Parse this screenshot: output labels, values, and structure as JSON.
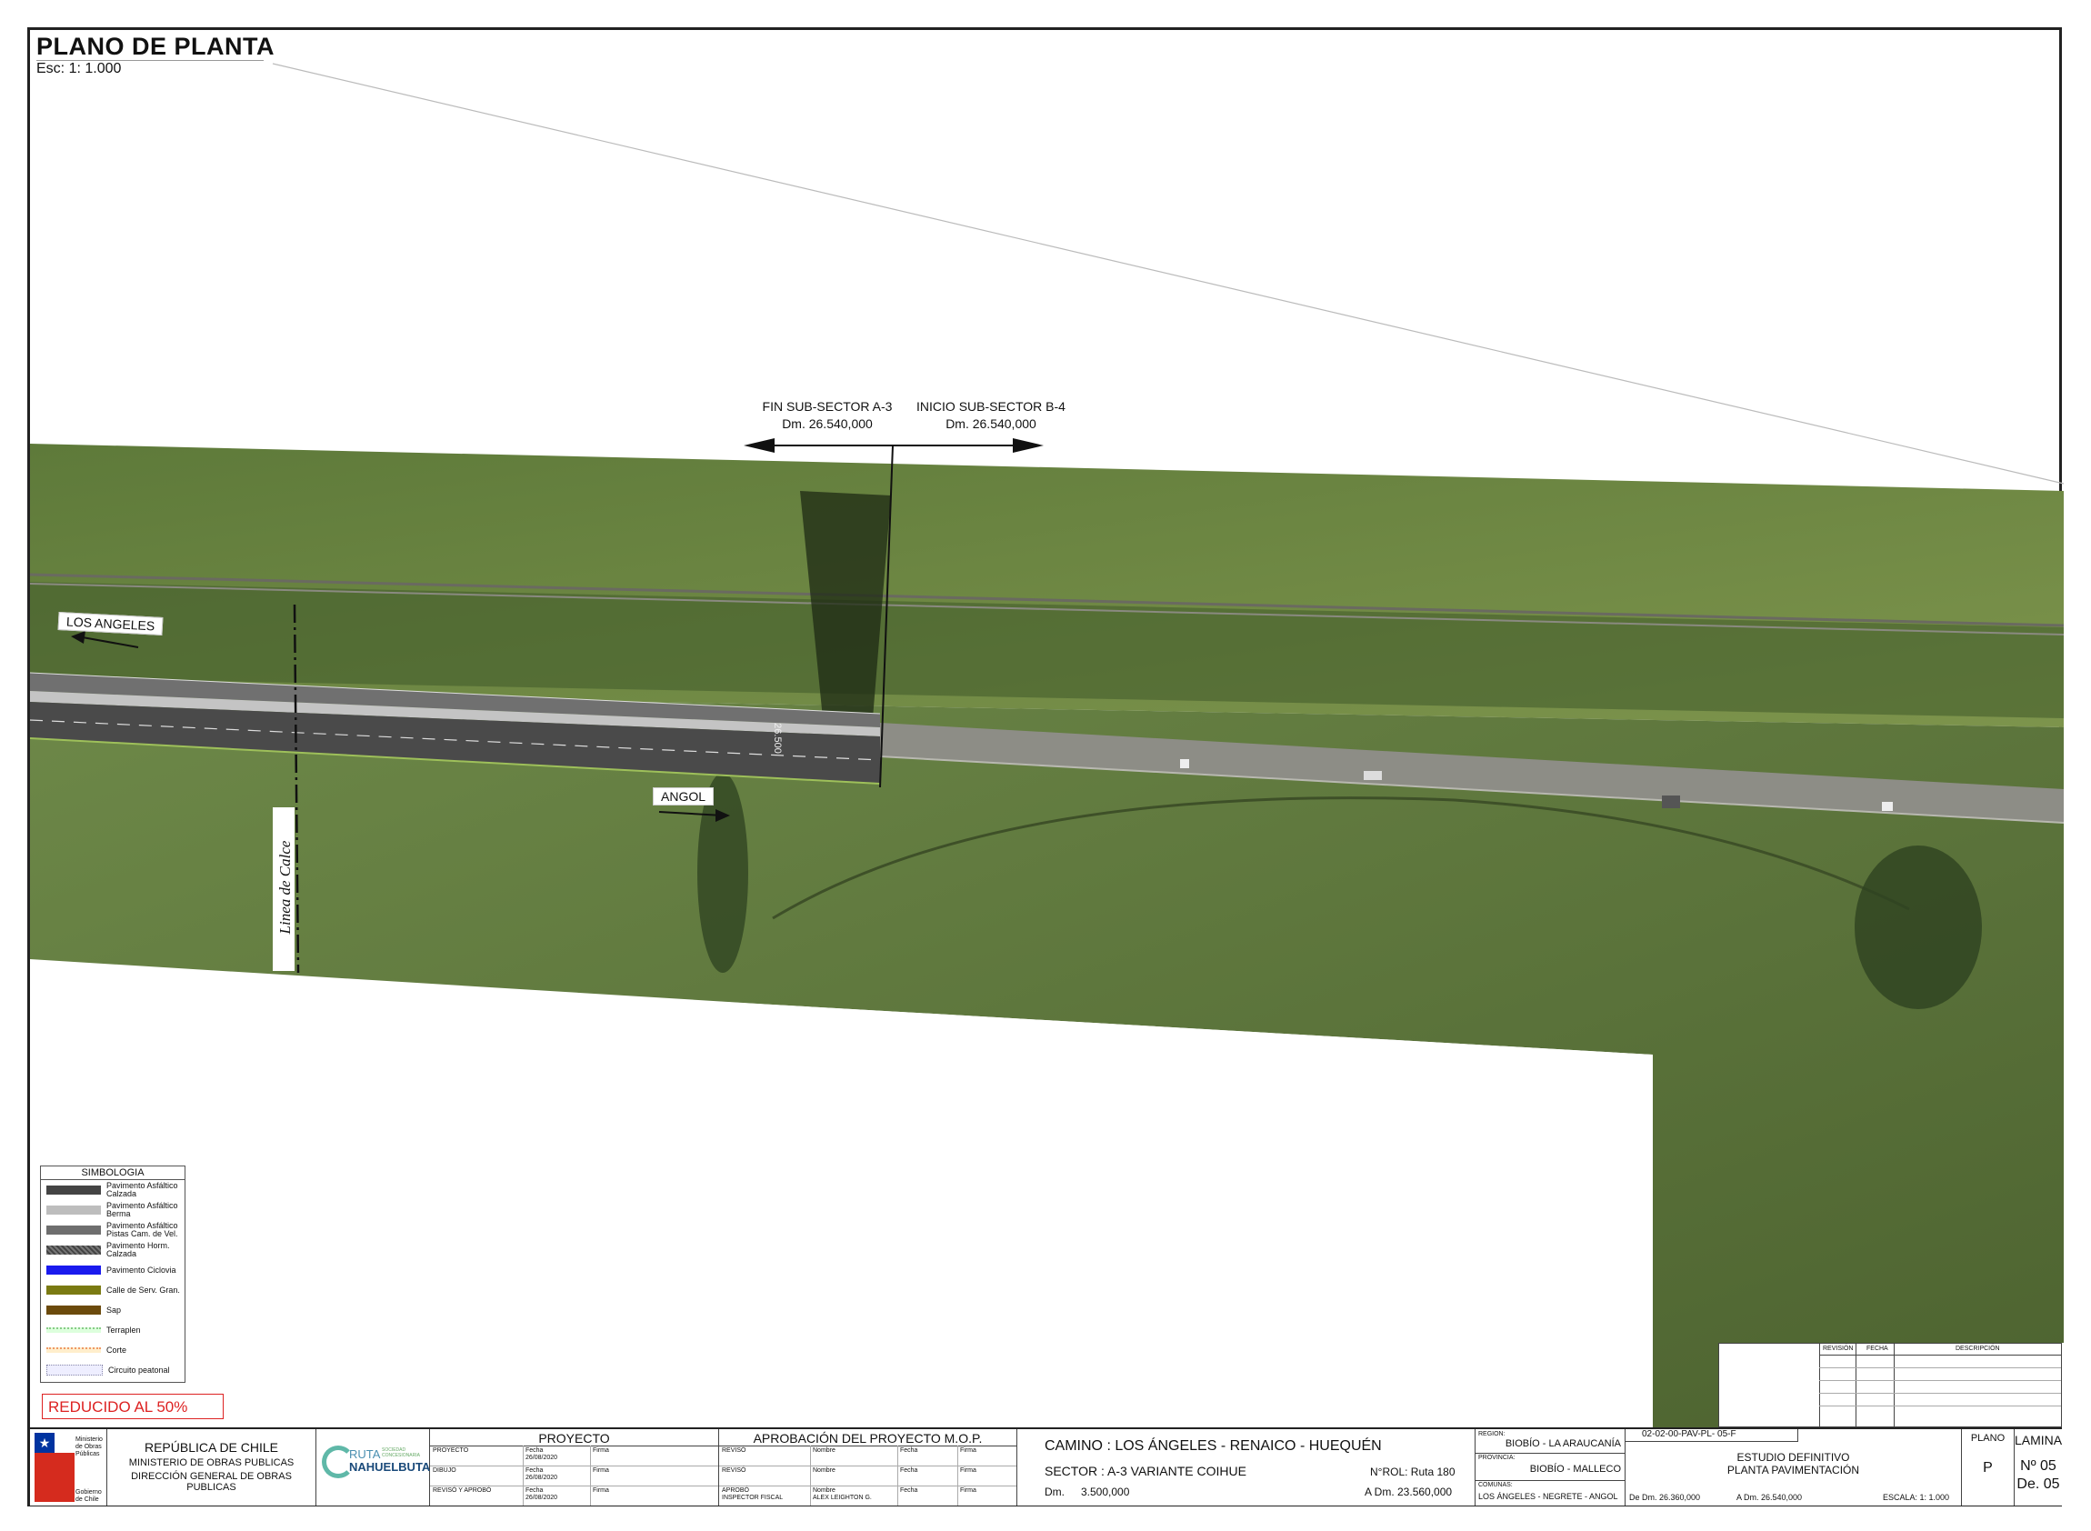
{
  "header": {
    "title": "PLANO DE PLANTA",
    "scale": "Esc: 1: 1.000"
  },
  "annotations": {
    "fin_title": "FIN SUB-SECTOR A-3",
    "fin_dm": "Dm. 26.540,000",
    "inicio_title": "INICIO SUB-SECTOR B-4",
    "inicio_dm": "Dm. 26.540,000",
    "los_angeles": "LOS ANGELES",
    "angol": "ANGOL",
    "chainage": "26.500",
    "linea_calce": "Linea de Calce"
  },
  "legend": {
    "title": "SIMBOLOGIA",
    "items": [
      {
        "label": "Pavimento Asfáltico Calzada",
        "color": "#444444"
      },
      {
        "label": "Pavimento Asfáltico Berma",
        "color": "#bdbdbd"
      },
      {
        "label": "Pavimento Asfáltico Pistas Cam. de Vel.",
        "color": "#6e6e6e"
      },
      {
        "label": "Pavimento Horm. Calzada",
        "color": "#555555"
      },
      {
        "label": "Pavimento Ciclovia",
        "color": "#1a1aee"
      },
      {
        "label": "Calle de Serv. Gran.",
        "color": "#7a7a12"
      },
      {
        "label": "Sap",
        "color": "#6b4a0c"
      },
      {
        "label": "Terraplen",
        "color": "#a8e0a8"
      },
      {
        "label": "Corte",
        "color": "#f0a070"
      },
      {
        "label": "Circuito peatonal",
        "color": "#c8d0f0"
      }
    ]
  },
  "reducido": "REDUCIDO AL 50%",
  "revision": {
    "col1": "REVISIÓN",
    "col2": "FECHA",
    "col3": "DESCRIPCIÓN"
  },
  "titleblock": {
    "logo_text": "Ministerio de Obras Públicas",
    "logo_sub": "Gobierno de Chile",
    "rep1": "REPÚBLICA DE CHILE",
    "rep2": "MINISTERIO DE OBRAS PUBLICAS",
    "rep3": "DIRECCIÓN GENERAL DE OBRAS PUBLICAS",
    "ruta_top": "RUTA",
    "ruta_bottom": "NAHUELBUTA",
    "ruta_tag": "SOCIEDAD CONCESIONARIA",
    "proyecto": "PROYECTO",
    "p_proyecto": "PROYECTO",
    "p_dibujo": "DIBUJO",
    "p_reviso": "REVISÓ Y APROBÓ",
    "fecha": "Fecha",
    "firma": "Firma",
    "date": "26/08/2020",
    "aprob_title": "APROBACIÓN DEL PROYECTO M.O.P.",
    "reviso": "REVISÓ",
    "aprobo": "APROBÓ",
    "inspector": "INSPECTOR FISCAL",
    "nombre": "Nombre",
    "alex": "ALEX LEIGHTON G.",
    "camino": "CAMINO : LOS ÁNGELES - RENAICO - HUEQUÉN",
    "sector": "SECTOR : A-3 VARIANTE COIHUE",
    "nrol": "N°ROL: Ruta 180",
    "dm_label": "Dm.",
    "dm_value": "3.500,000",
    "adm": "A Dm.  23.560,000",
    "region_label": "REGION:",
    "region": "BIOBÍO - LA ARAUCANÍA",
    "provincia_label": "PROVINCIA:",
    "provincia": "BIOBÍO - MALLECO",
    "comunas_label": "COMUNAS:",
    "comunas": "LOS ÁNGELES - NEGRETE - ANGOL",
    "code": "02-02-00-PAV-PL- 05-F",
    "estudio": "ESTUDIO DEFINITIVO",
    "planta": "PLANTA PAVIMENTACIÓN",
    "de_dm": "De Dm. 26.360,000",
    "a_dm": "A Dm.  26.540,000",
    "escala": "ESCALA:  1: 1.000",
    "plano_label": "PLANO",
    "plano_value": "P",
    "lamina_label": "LAMINA",
    "lamina_no": "Nº   05",
    "lamina_de": "De. 05"
  }
}
